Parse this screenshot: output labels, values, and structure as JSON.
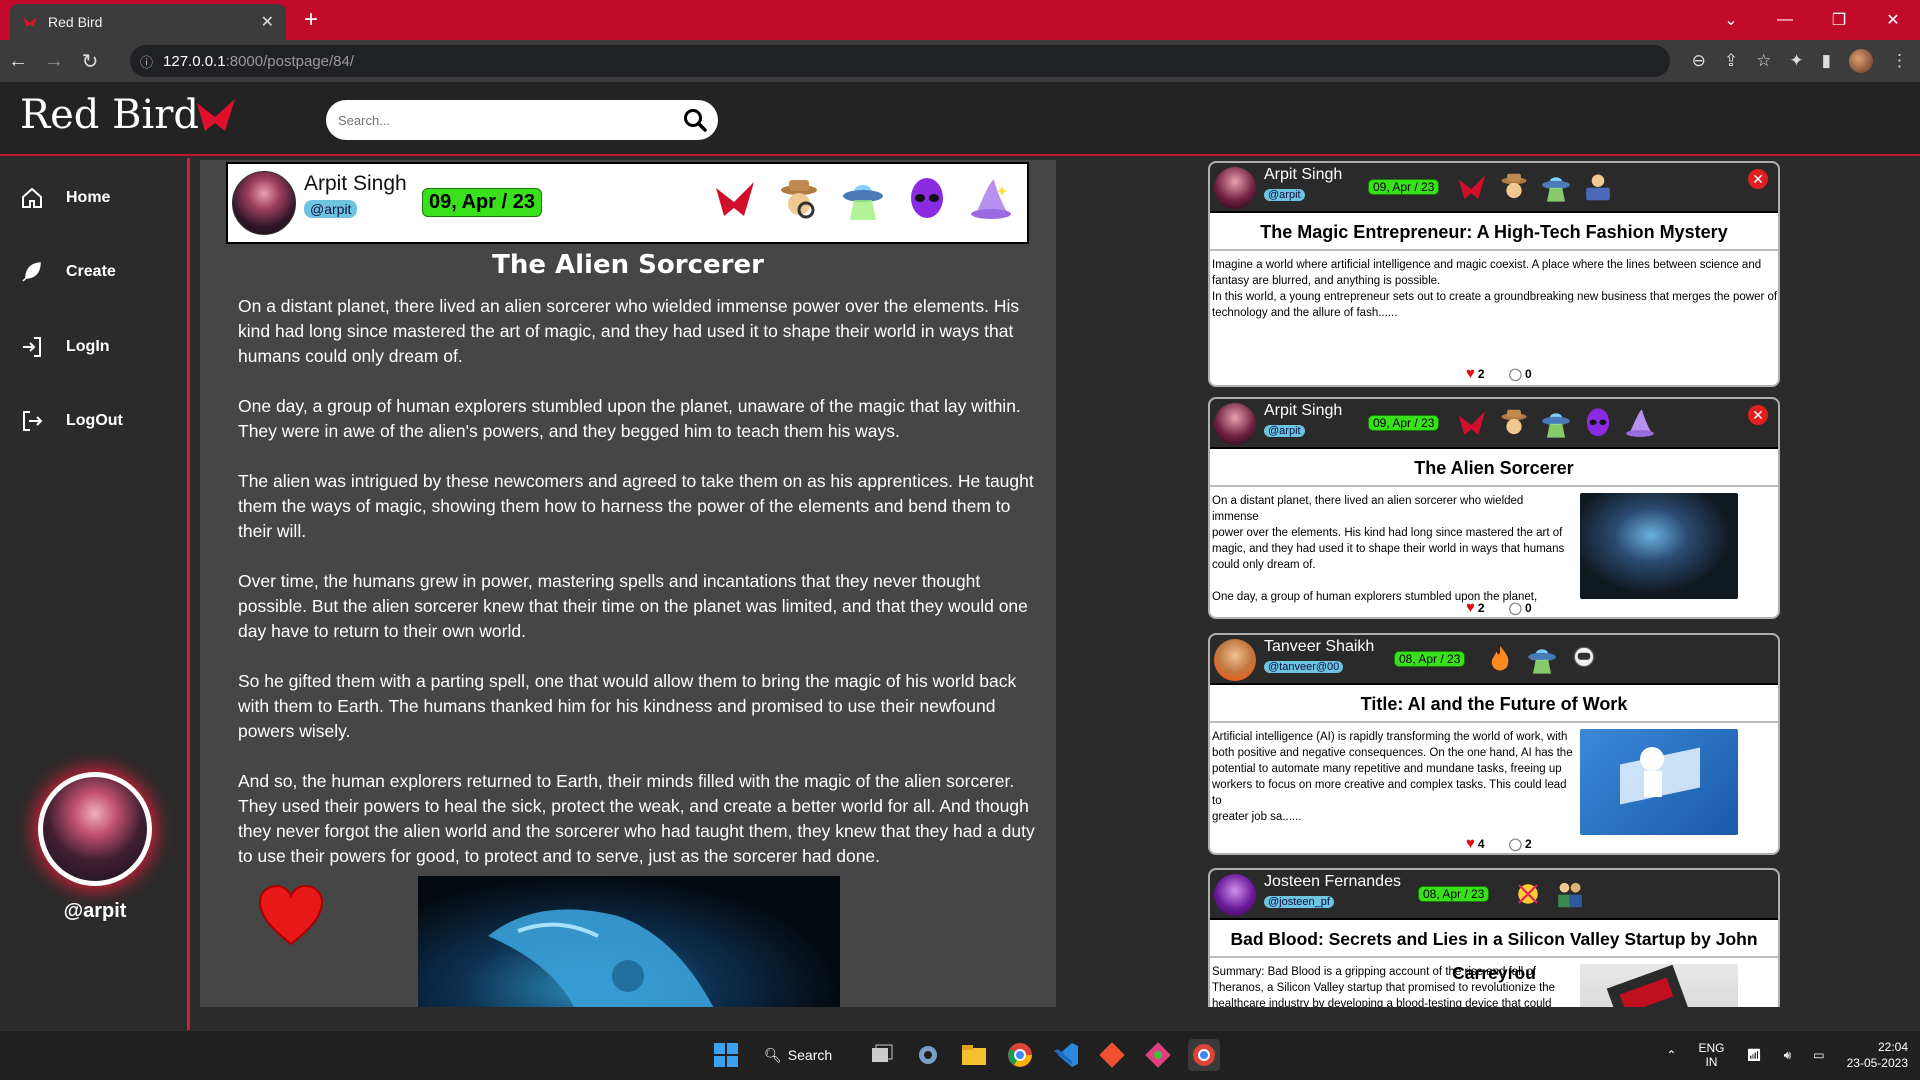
{
  "browser": {
    "tab_title": "Red Bird",
    "url_host": "127.0.0.1",
    "url_rest": ":8000/postpage/84/"
  },
  "site": {
    "logo": "Red Bird",
    "search_placeholder": "Search..."
  },
  "sidebar": {
    "items": [
      {
        "label": "Home",
        "icon": "home-icon"
      },
      {
        "label": "Create",
        "icon": "feather-icon"
      },
      {
        "label": "LogIn",
        "icon": "login-icon"
      },
      {
        "label": "LogOut",
        "icon": "logout-icon"
      }
    ],
    "profile_handle": "@arpit"
  },
  "post": {
    "author": "Arpit Singh",
    "handle": "@arpit",
    "date": "09, Apr / 23",
    "title": "The Alien Sorcerer",
    "paragraphs": [
      "On a distant planet, there lived an alien sorcerer who wielded immense power over the elements. His kind had long since mastered the art of magic, and they had used it to shape their world in ways that humans could only dream of.",
      "One day, a group of human explorers stumbled upon the planet, unaware of the magic that lay within. They were in awe of the alien's powers, and they begged him to teach them his ways.",
      "The alien was intrigued by these newcomers and agreed to take them on as his apprentices. He taught them the ways of magic, showing them how to harness the power of the elements and bend them to their will.",
      "Over time, the humans grew in power, mastering spells and incantations that they never thought possible. But the alien sorcerer knew that their time on the planet was limited, and that they would one day have to return to their own world.",
      "So he gifted them with a parting spell, one that would allow them to bring the magic of his world back with them to Earth. The humans thanked him for his kindness and promised to use their newfound powers wisely.",
      "And so, the human explorers returned to Earth, their minds filled with the magic of the alien sorcerer. They used their powers to heal the sick, protect the weak, and create a better world for all. And though they never forgot the alien world and the sorcerer who had taught them, they knew that they had a duty to use their powers for good, to protect and to serve, just as the sorcerer had done."
    ]
  },
  "feed": [
    {
      "author": "Arpit Singh",
      "handle": "@arpit",
      "date": "09, Apr / 23",
      "title": "The Magic Entrepreneur: A High-Tech Fashion Mystery",
      "body": [
        "Imagine a world where artificial intelligence and magic coexist. A place where the lines between science and",
        "fantasy are blurred, and anything is possible.",
        "In this world, a young entrepreneur sets out to create a groundbreaking new business that merges the power of",
        "technology and the allure of fash......"
      ],
      "likes": "2",
      "comments": "0"
    },
    {
      "author": "Arpit Singh",
      "handle": "@arpit",
      "date": "09, Apr / 23",
      "title": "The Alien Sorcerer",
      "body": [
        "On a distant planet, there lived an alien sorcerer who wielded immense",
        "power over the elements. His kind had long since mastered the art of",
        "magic, and they had used it to shape their world in ways that humans",
        "could only dream of.",
        "",
        "One day, a group of human explorers stumbled upon the planet,"
      ],
      "likes": "2",
      "comments": "0"
    },
    {
      "author": "Tanveer Shaikh",
      "handle": "@tanveer@00",
      "date": "08, Apr / 23",
      "title": "Title: AI and the Future of Work",
      "body": [
        "Artificial intelligence (AI) is rapidly transforming the world of work, with",
        "both positive and negative consequences. On the one hand, AI has the",
        "potential to automate many repetitive and mundane tasks, freeing up",
        "workers to focus on more creative and complex tasks. This could lead to",
        "greater job sa......"
      ],
      "likes": "4",
      "comments": "2"
    },
    {
      "author": "Josteen Fernandes",
      "handle": "@josteen_pf",
      "date": "08, Apr / 23",
      "title": "Bad Blood: Secrets and Lies in a Silicon Valley Startup by John Carreyrou",
      "body": [
        "Summary: Bad Blood is a gripping account of the rise and fall of",
        "Theranos, a Silicon Valley startup that promised to revolutionize the",
        "healthcare industry by developing a blood-testing device that could"
      ],
      "likes": "",
      "comments": ""
    }
  ],
  "taskbar": {
    "search_label": "Search",
    "lang_top": "ENG",
    "lang_bottom": "IN",
    "time": "22:04",
    "date": "23-05-2023"
  },
  "colors": {
    "brand_red": "#c20a2b",
    "accent_red": "#d61f35",
    "date_green": "#39e01c",
    "handle_blue": "#6cc4e0"
  }
}
